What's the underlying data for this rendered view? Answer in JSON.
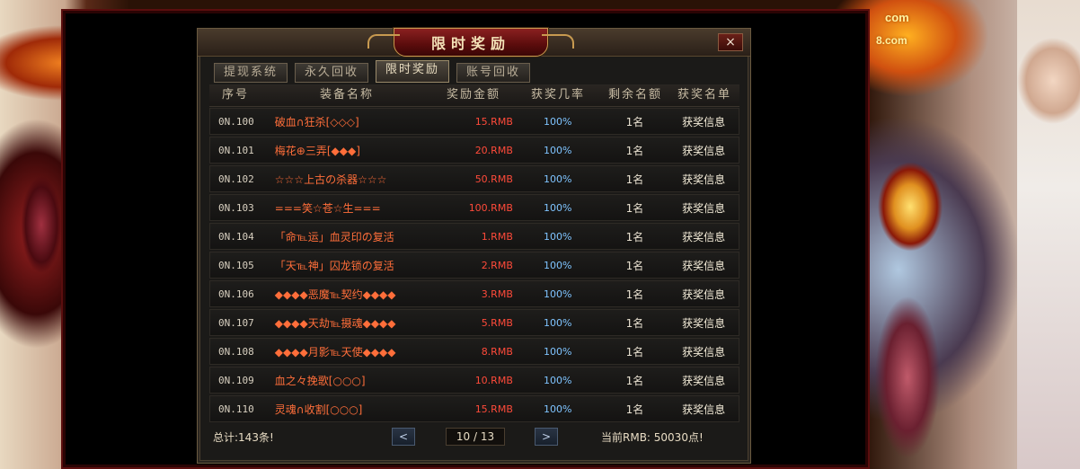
{
  "panel": {
    "title": "限时奖励",
    "close": "×",
    "tabs": [
      "提现系统",
      "永久回收",
      "限时奖励",
      "账号回收"
    ],
    "active_tab": 2,
    "columns": [
      "序号",
      "装备名称",
      "奖励金额",
      "获奖几率",
      "剩余名额",
      "获奖名单"
    ],
    "rows": [
      {
        "no": "0N.100",
        "name": "破血∩狂杀[◇◇◇]",
        "amount": "15.RMB",
        "rate": "100%",
        "left": "1名",
        "info": "获奖信息"
      },
      {
        "no": "0N.101",
        "name": "梅花⊕三弄[◆◆◆]",
        "amount": "20.RMB",
        "rate": "100%",
        "left": "1名",
        "info": "获奖信息"
      },
      {
        "no": "0N.102",
        "name": "☆☆☆上古の杀器☆☆☆",
        "amount": "50.RMB",
        "rate": "100%",
        "left": "1名",
        "info": "获奖信息"
      },
      {
        "no": "0N.103",
        "name": "===笑☆苍☆生===",
        "amount": "100.RMB",
        "rate": "100%",
        "left": "1名",
        "info": "获奖信息"
      },
      {
        "no": "0N.104",
        "name": "「命℡运」血灵印の复活",
        "amount": "1.RMB",
        "rate": "100%",
        "left": "1名",
        "info": "获奖信息"
      },
      {
        "no": "0N.105",
        "name": "「天℡神」囚龙锁の复活",
        "amount": "2.RMB",
        "rate": "100%",
        "left": "1名",
        "info": "获奖信息"
      },
      {
        "no": "0N.106",
        "name": "◆◆◆◆恶魔℡契约◆◆◆◆",
        "amount": "3.RMB",
        "rate": "100%",
        "left": "1名",
        "info": "获奖信息"
      },
      {
        "no": "0N.107",
        "name": "◆◆◆◆天劫℡摄魂◆◆◆◆",
        "amount": "5.RMB",
        "rate": "100%",
        "left": "1名",
        "info": "获奖信息"
      },
      {
        "no": "0N.108",
        "name": "◆◆◆◆月影℡天使◆◆◆◆",
        "amount": "8.RMB",
        "rate": "100%",
        "left": "1名",
        "info": "获奖信息"
      },
      {
        "no": "0N.109",
        "name": "血之々挽歌[○○○]",
        "amount": "10.RMB",
        "rate": "100%",
        "left": "1名",
        "info": "获奖信息"
      },
      {
        "no": "0N.110",
        "name": "灵魂∩收割[○○○]",
        "amount": "15.RMB",
        "rate": "100%",
        "left": "1名",
        "info": "获奖信息"
      }
    ],
    "footer": {
      "total": "总计:143条!",
      "prev": "<",
      "next": ">",
      "page": "10 / 13",
      "balance": "当前RMB: 50030点!"
    }
  },
  "background": {
    "watermark_top": "com",
    "watermark_bottom": "8.com"
  }
}
